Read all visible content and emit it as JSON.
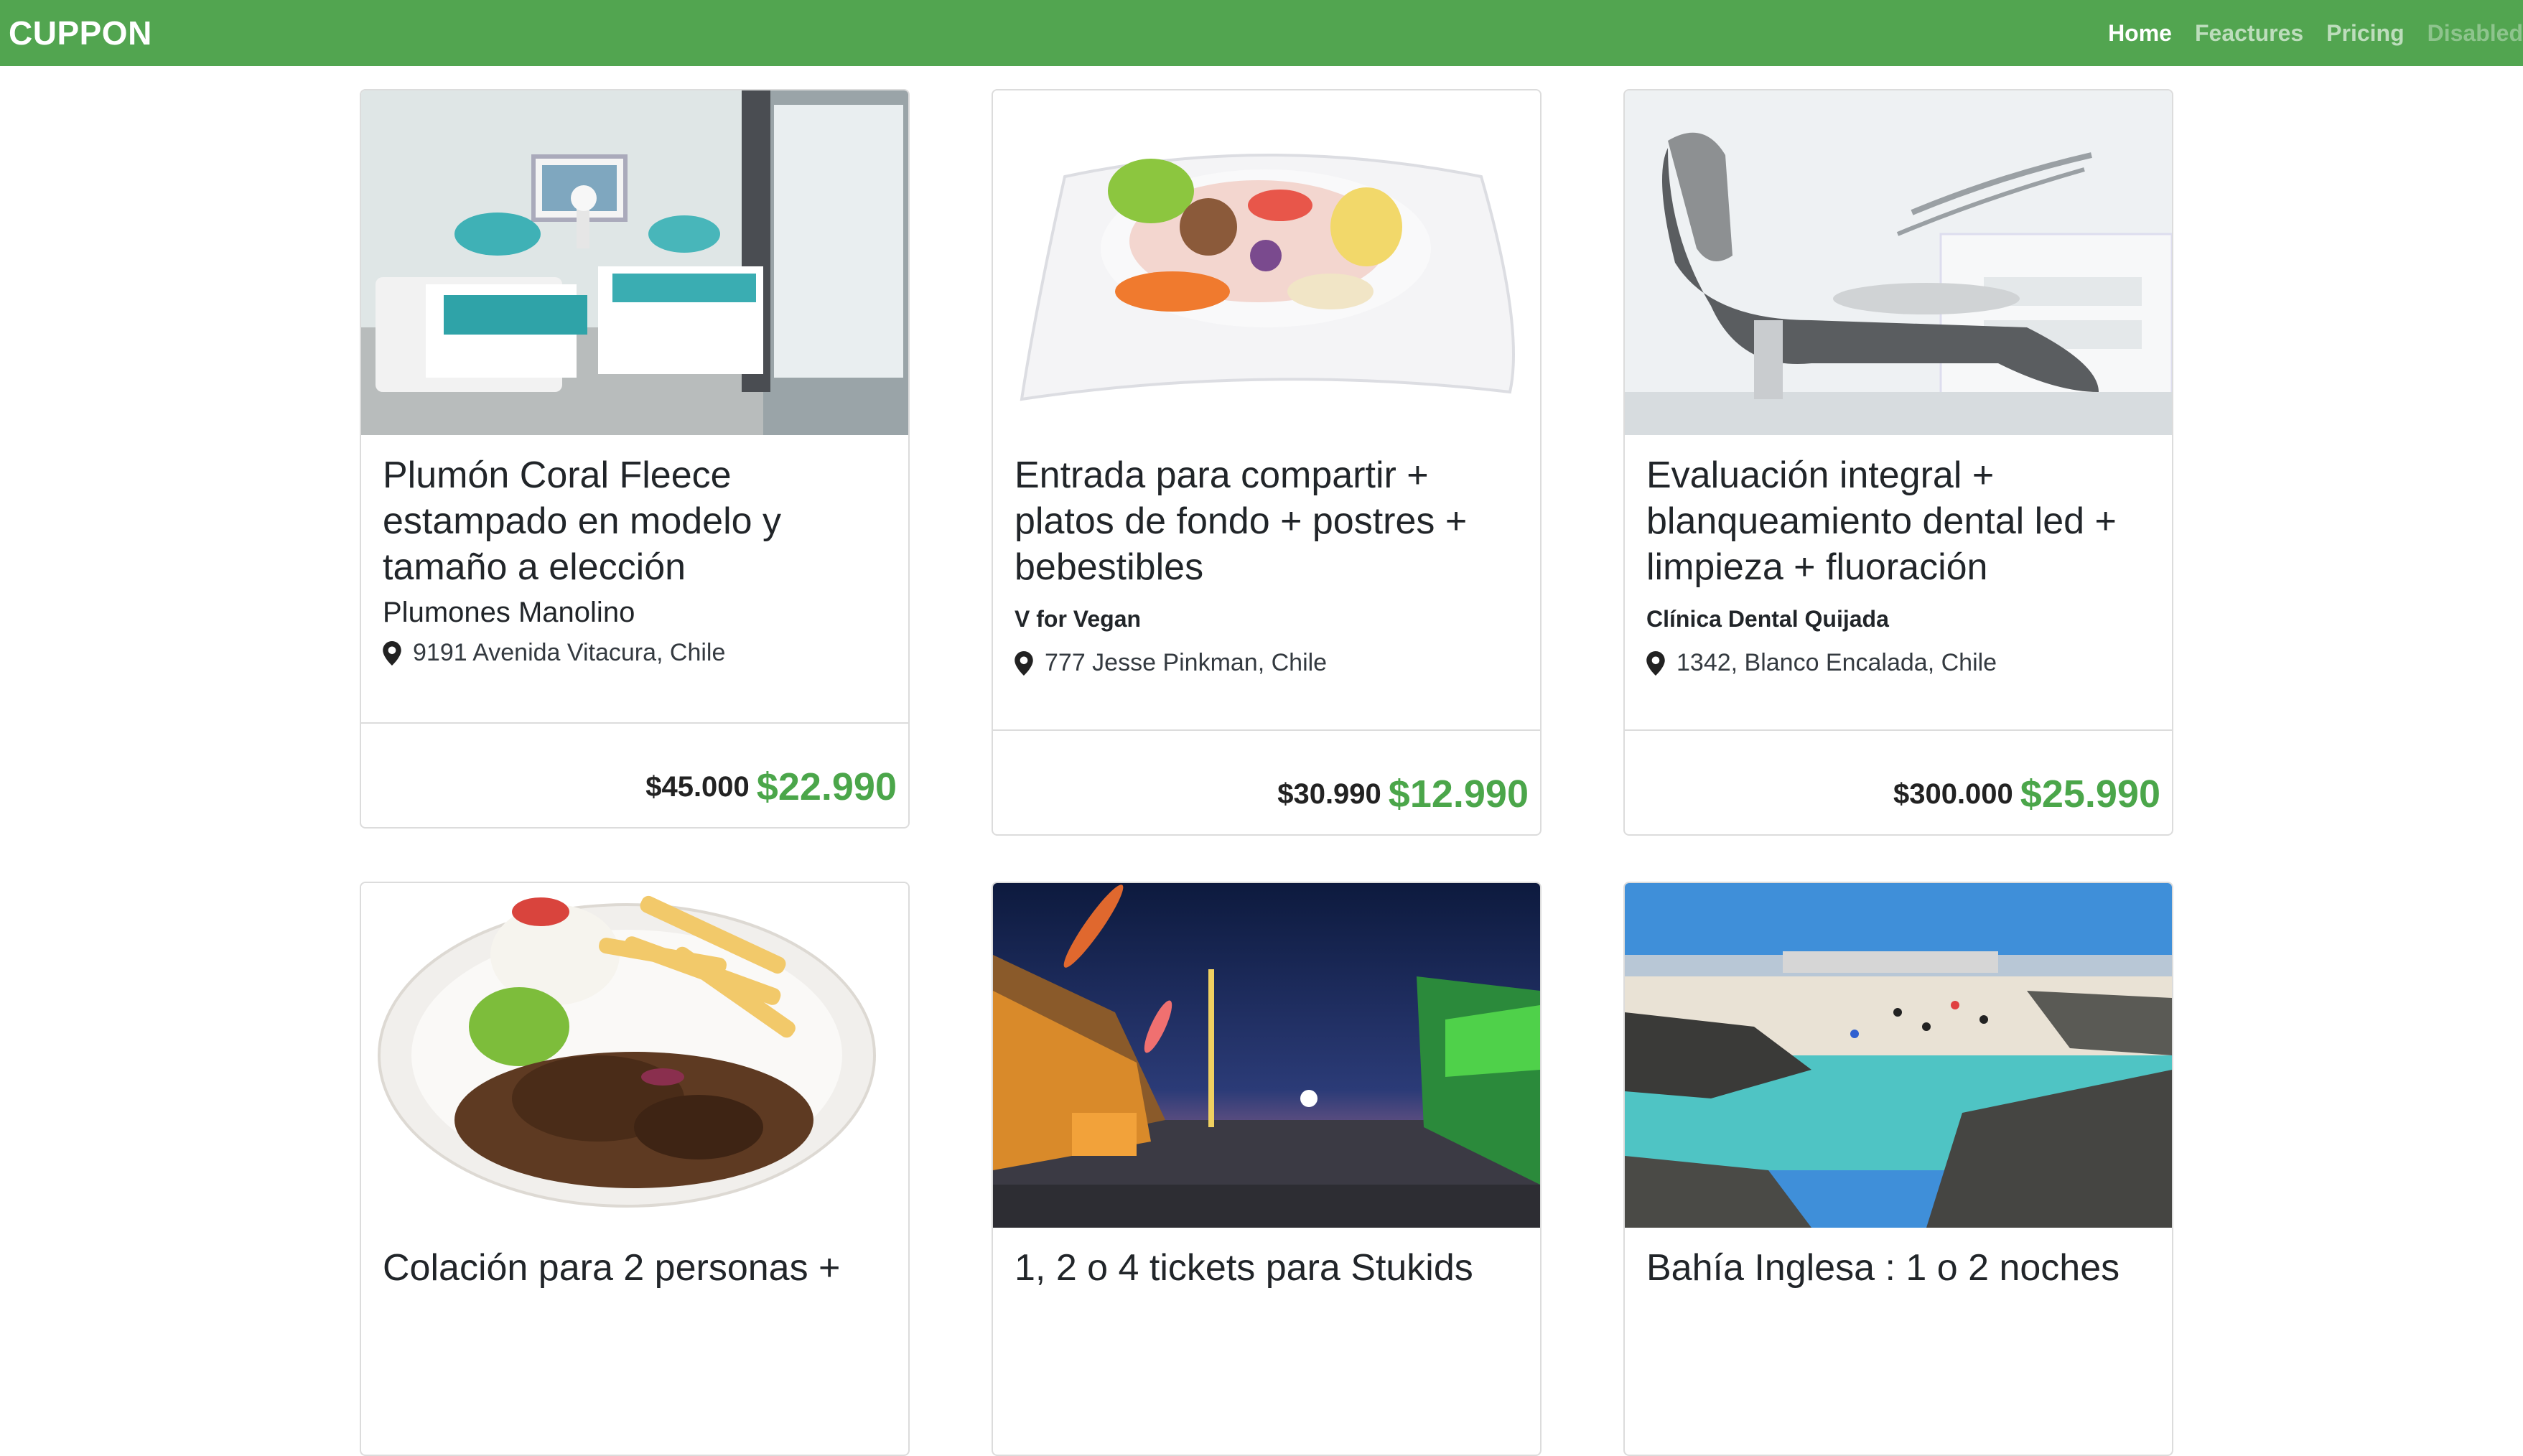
{
  "brand": "CUPPON",
  "nav": {
    "home": "Home",
    "features": "Feactures",
    "pricing": "Pricing",
    "disabled": "Disabled"
  },
  "colors": {
    "navbar": "#52a550",
    "price_accent": "#4ba64a"
  },
  "deals": [
    {
      "image": "hotel-bedroom-photo",
      "title": "Plumón Coral Fleece estampado en modelo y tamaño a elección",
      "merchant": "Plumones Manolino",
      "location": "9191 Avenida Vitacura, Chile",
      "old_price": "$45.000",
      "new_price": "$22.990"
    },
    {
      "image": "ceviche-plate-photo",
      "title": "Entrada para compartir + platos de fondo + postres + bebestibles",
      "merchant": "V for Vegan",
      "location": "777 Jesse Pinkman, Chile",
      "old_price": "$30.990",
      "new_price": "$12.990"
    },
    {
      "image": "dental-chair-photo",
      "title": "Evaluación integral + blanqueamiento dental led + limpieza + fluoración",
      "merchant": "Clínica Dental Quijada",
      "location": "1342, Blanco Encalada, Chile",
      "old_price": "$300.000",
      "new_price": "$25.990"
    },
    {
      "image": "lomo-saltado-plate-photo",
      "title": "Colación para 2 personas +"
    },
    {
      "image": "amusement-park-night-photo",
      "title": "1, 2 o 4 tickets para Stukids"
    },
    {
      "image": "beach-bay-photo",
      "title": "Bahía Inglesa : 1 o 2 noches"
    }
  ]
}
